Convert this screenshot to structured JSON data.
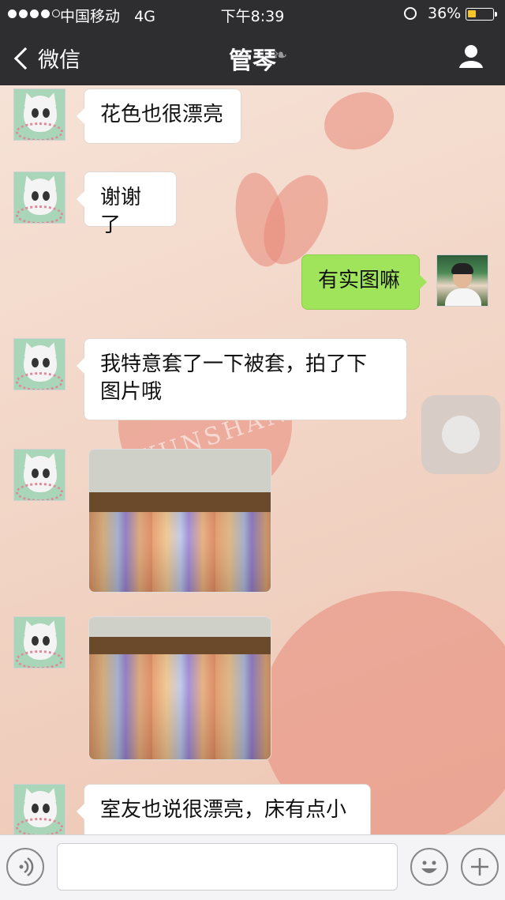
{
  "status_bar": {
    "carrier": "中国移动",
    "network": "4G",
    "time": "下午8:39",
    "battery_percent_text": "36%",
    "battery_level": 0.36
  },
  "nav": {
    "back_label": "微信",
    "title": "管琴"
  },
  "messages": [
    {
      "sender": "them",
      "type": "text",
      "text": "花色也很漂亮"
    },
    {
      "sender": "them",
      "type": "text",
      "text": "谢谢了"
    },
    {
      "sender": "me",
      "type": "text",
      "text": "有实图嘛"
    },
    {
      "sender": "them",
      "type": "text",
      "text": "我特意套了一下被套，拍了下\n图片哦"
    },
    {
      "sender": "them",
      "type": "image"
    },
    {
      "sender": "them",
      "type": "image"
    },
    {
      "sender": "them",
      "type": "text",
      "text": "室友也说很漂亮，床有点小"
    }
  ],
  "watermark": "KUNSHAN BBS",
  "colors": {
    "header": "#2e2e30",
    "my_bubble": "#9fe45a",
    "their_bubble": "#ffffff",
    "battery_fill": "#f6c529"
  },
  "icons": {
    "back": "chevron-left-icon",
    "ear": "ear-icon",
    "profile": "person-icon",
    "voice": "voice-icon",
    "emoji": "emoji-icon",
    "add": "plus-icon"
  }
}
